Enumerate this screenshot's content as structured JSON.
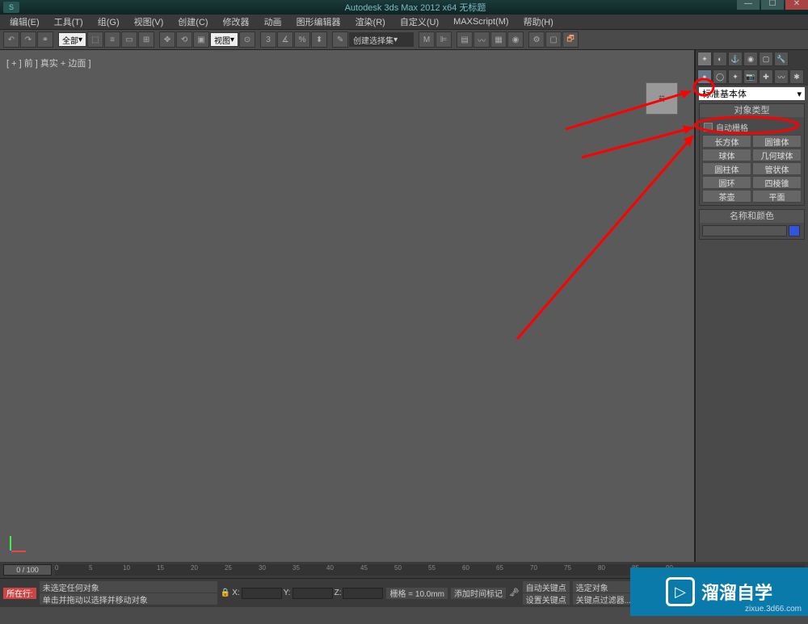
{
  "title": "Autodesk 3ds Max 2012 x64   无标题",
  "menu": [
    "编辑(E)",
    "工具(T)",
    "组(G)",
    "视图(V)",
    "创建(C)",
    "修改器",
    "动画",
    "图形编辑器",
    "渲染(R)",
    "自定义(U)",
    "MAXScript(M)",
    "帮助(H)"
  ],
  "toolbar": {
    "filter_dropdown": "全部",
    "view_dropdown": "视图",
    "selection_set": "创建选择集"
  },
  "viewport": {
    "label": "[ + ] 前 ] 真实 + 边面 ]",
    "viewcube": "前"
  },
  "command_panel": {
    "dropdown": "标准基本体",
    "rollout_object_type": "对象类型",
    "auto_grid": "自动栅格",
    "primitives": [
      [
        "长方体",
        "圆锥体"
      ],
      [
        "球体",
        "几何球体"
      ],
      [
        "圆柱体",
        "管状体"
      ],
      [
        "圆环",
        "四棱锥"
      ],
      [
        "茶壶",
        "平面"
      ]
    ],
    "rollout_name_color": "名称和颜色"
  },
  "timeline": {
    "slider": "0 / 100",
    "ticks": [
      "0",
      "5",
      "10",
      "15",
      "20",
      "25",
      "30",
      "35",
      "40",
      "45",
      "50",
      "55",
      "60",
      "65",
      "70",
      "75",
      "80",
      "85",
      "90"
    ]
  },
  "status": {
    "row_label": "所在行:",
    "selection": "未选定任何对象",
    "hint": "单击并拖动以选择并移动对象",
    "add_time_tag": "添加时间标记",
    "x": "X:",
    "y": "Y:",
    "z": "Z:",
    "grid": "栅格 = 10.0mm",
    "auto_key": "自动关键点",
    "selected_obj": "选定对象",
    "set_key": "设置关键点",
    "key_filters": "关键点过滤器..."
  },
  "watermark": {
    "text": "溜溜自学",
    "url": "zixue.3d66.com"
  }
}
